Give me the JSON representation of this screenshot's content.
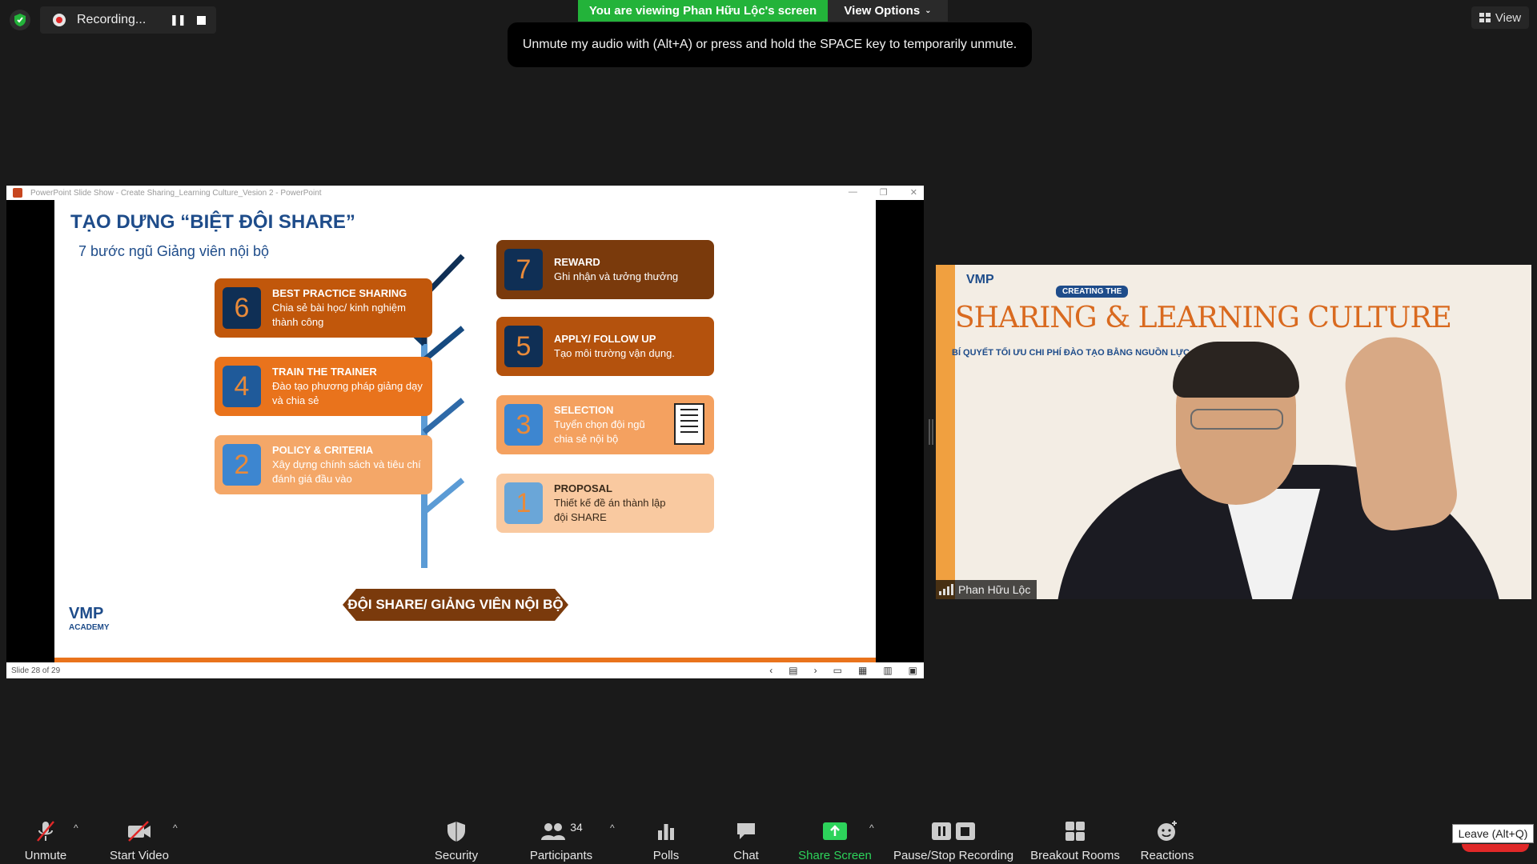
{
  "topbar": {
    "recording_label": "Recording...",
    "viewing_banner": "You are viewing Phan Hữu Lộc's screen",
    "view_options_label": "View Options",
    "unmute_tip": "Unmute my audio with (Alt+A) or press and hold the SPACE key to temporarily unmute.",
    "view_label": "View"
  },
  "ppt": {
    "window_title": "PowerPoint Slide Show  -  Create Sharing_Learning Culture_Vesion 2  -  PowerPoint",
    "status_left": "Slide 28 of 29",
    "slide": {
      "title": "TẠO DỰNG “BIỆT ĐỘI SHARE”",
      "subtitle": "7 bước ngũ Giảng viên nội bộ",
      "steps": {
        "s6": {
          "num": "6",
          "title": "BEST PRACTICE SHARING",
          "desc": "Chia sẻ bài học/ kinh nghiệm thành công"
        },
        "s4": {
          "num": "4",
          "title": "TRAIN THE TRAINER",
          "desc": "Đào tạo phương pháp giảng dạy và chia sẻ"
        },
        "s2": {
          "num": "2",
          "title": "POLICY & CRITERIA",
          "desc": "Xây dựng chính sách và tiêu chí đánh giá đầu vào"
        },
        "s7": {
          "num": "7",
          "title": "REWARD",
          "desc": "Ghi nhận và tưởng thưởng"
        },
        "s5": {
          "num": "5",
          "title": "APPLY/ FOLLOW UP",
          "desc": "Tạo môi trường vận dụng."
        },
        "s3": {
          "num": "3",
          "title": "SELECTION",
          "desc": "Tuyển chọn đội ngũ chia sẻ nội bộ"
        },
        "s1": {
          "num": "1",
          "title": "PROPOSAL",
          "desc": "Thiết kế đề án thành lập đội SHARE"
        }
      },
      "base_banner": "ĐỘI SHARE/ GIẢNG VIÊN NỘI BỘ",
      "logo_text": "VMP",
      "logo_sub": "ACADEMY"
    }
  },
  "video": {
    "logo_text": "VMP",
    "creating_label": "CREATING THE",
    "heading": "SHARING & LEARNING CULTURE",
    "subheading": "BÍ QUYẾT TỐI ƯU CHI PHÍ ĐÀO TẠO BẰNG NGUỒN LỰC NỘI",
    "participant_name": "Phan Hữu Lộc"
  },
  "toolbar": {
    "unmute": "Unmute",
    "start_video": "Start Video",
    "security": "Security",
    "participants": "Participants",
    "participants_count": "34",
    "polls": "Polls",
    "chat": "Chat",
    "share_screen": "Share Screen",
    "pause_stop_recording": "Pause/Stop Recording",
    "breakout_rooms": "Breakout Rooms",
    "reactions": "Reactions",
    "leave_tooltip": "Leave (Alt+Q)"
  },
  "colors": {
    "zoom_green": "#23b33a",
    "share_green": "#2dd35b",
    "slide_navy": "#1e4c8a",
    "orange_dark": "#7a3a0c",
    "orange_mid": "#e9731c",
    "leave_red": "#e02828"
  }
}
